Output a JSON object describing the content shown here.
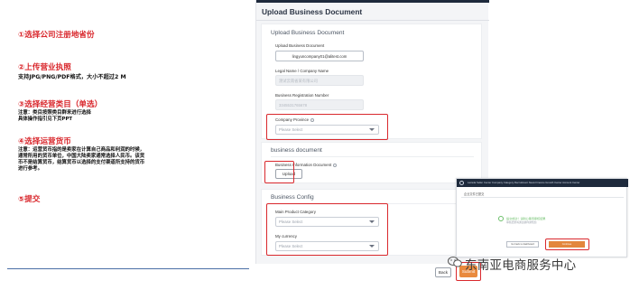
{
  "instructions": [
    {
      "title": "①选择公司注册地省份",
      "notes": []
    },
    {
      "title": "②上传营业执照",
      "notes": [
        "支持JPG/PNG/PDF格式，大小不超过2 M"
      ]
    },
    {
      "title": "③选择经营类目（单选）",
      "notes": [
        "注意：类目按照类目群来进行选择",
        "具体操作指引见下页PPT"
      ]
    },
    {
      "title": "④选择运营货币",
      "notes": [
        "注意：运营货币指的是卖家在计算自己商品和利润的时候，",
        "通常所用的货币单位，中国大陆卖家通常选择人民币。该货",
        "币不是结算货币，结算货币以选择的支付渠道所支持的货币",
        "进行参考。"
      ]
    },
    {
      "title": "⑤提交",
      "notes": []
    }
  ],
  "form": {
    "header": "Upload Business Document",
    "section1_title": "Upload Business Document",
    "upload_label": "Upload Business Document",
    "email_value": "lingyuncompany01@alitest.com",
    "legal_name_label": "Legal Name / Company Name",
    "legal_name_value": "测试云南省某有限公司",
    "reg_number_label": "Business Registration Number",
    "reg_number_value": "3345531765678",
    "province_label": "Company Province",
    "province_placeholder": "Please Select",
    "section2_title": "business document",
    "business_info_label": "Business Information Document",
    "upload_button": "Upload",
    "section3_title": "Business Config",
    "category_label": "Main Product Category",
    "category_placeholder": "Please Select",
    "currency_label": "My currency",
    "currency_placeholder": "Please Select",
    "back_button": "Back",
    "submit_button": "Submit"
  },
  "thumbnail": {
    "nav": "Lazada Seller Center  Company  Category  Recruitment  News  Finance  Growth Center  Account Center",
    "title": "企业文件已提交",
    "message": "提交成功！请耐心等待审核结果",
    "sub_message": "审核结果将通过邮件通知您",
    "left_button": "Go back to dashboard",
    "right_button": "Continue"
  },
  "watermark": "东南亚电商服务中心",
  "colors": {
    "accent_red": "#d9282d",
    "submit_orange": "#e98a3e",
    "topbar": "#1e2a3c"
  }
}
